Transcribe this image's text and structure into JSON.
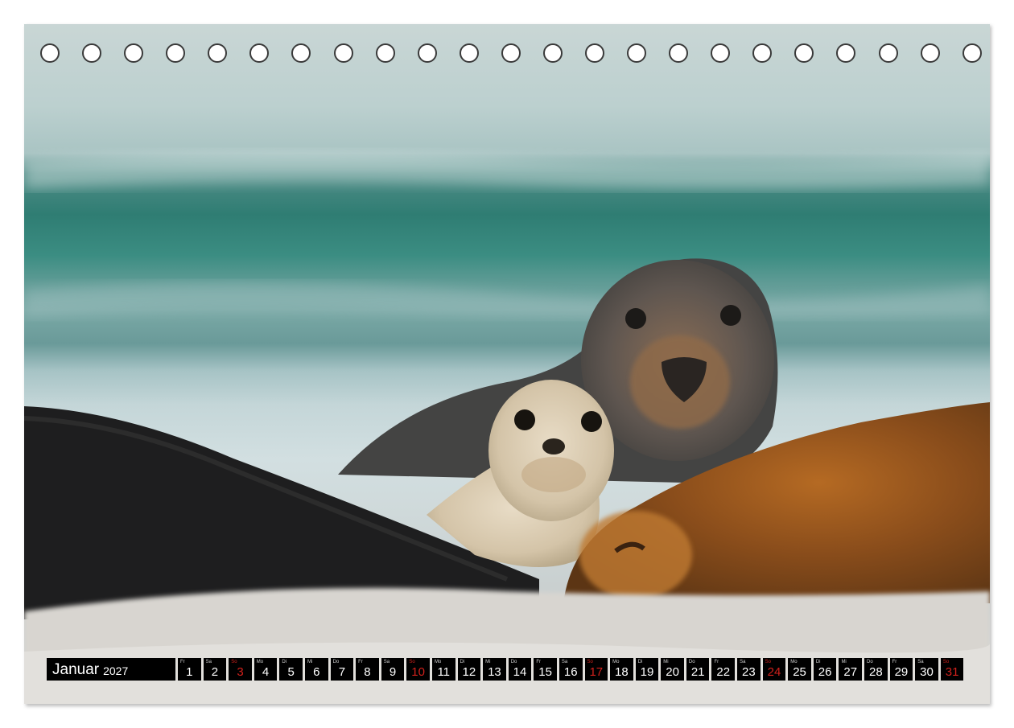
{
  "month": {
    "name": "Januar",
    "year": "2027"
  },
  "days": [
    {
      "wd": "Fr",
      "n": "1",
      "sunday": false
    },
    {
      "wd": "Sa",
      "n": "2",
      "sunday": false
    },
    {
      "wd": "So",
      "n": "3",
      "sunday": true
    },
    {
      "wd": "Mo",
      "n": "4",
      "sunday": false
    },
    {
      "wd": "Di",
      "n": "5",
      "sunday": false
    },
    {
      "wd": "Mi",
      "n": "6",
      "sunday": false
    },
    {
      "wd": "Do",
      "n": "7",
      "sunday": false
    },
    {
      "wd": "Fr",
      "n": "8",
      "sunday": false
    },
    {
      "wd": "Sa",
      "n": "9",
      "sunday": false
    },
    {
      "wd": "So",
      "n": "10",
      "sunday": true
    },
    {
      "wd": "Mo",
      "n": "11",
      "sunday": false
    },
    {
      "wd": "Di",
      "n": "12",
      "sunday": false
    },
    {
      "wd": "Mi",
      "n": "13",
      "sunday": false
    },
    {
      "wd": "Do",
      "n": "14",
      "sunday": false
    },
    {
      "wd": "Fr",
      "n": "15",
      "sunday": false
    },
    {
      "wd": "Sa",
      "n": "16",
      "sunday": false
    },
    {
      "wd": "So",
      "n": "17",
      "sunday": true
    },
    {
      "wd": "Mo",
      "n": "18",
      "sunday": false
    },
    {
      "wd": "Di",
      "n": "19",
      "sunday": false
    },
    {
      "wd": "Mi",
      "n": "20",
      "sunday": false
    },
    {
      "wd": "Do",
      "n": "21",
      "sunday": false
    },
    {
      "wd": "Fr",
      "n": "22",
      "sunday": false
    },
    {
      "wd": "Sa",
      "n": "23",
      "sunday": false
    },
    {
      "wd": "So",
      "n": "24",
      "sunday": true
    },
    {
      "wd": "Mo",
      "n": "25",
      "sunday": false
    },
    {
      "wd": "Di",
      "n": "26",
      "sunday": false
    },
    {
      "wd": "Mi",
      "n": "27",
      "sunday": false
    },
    {
      "wd": "Do",
      "n": "28",
      "sunday": false
    },
    {
      "wd": "Fr",
      "n": "29",
      "sunday": false
    },
    {
      "wd": "Sa",
      "n": "30",
      "sunday": false
    },
    {
      "wd": "So",
      "n": "31",
      "sunday": true
    }
  ],
  "colors": {
    "strip": "#000000",
    "sunday": "#d0211c",
    "text": "#ffffff"
  }
}
